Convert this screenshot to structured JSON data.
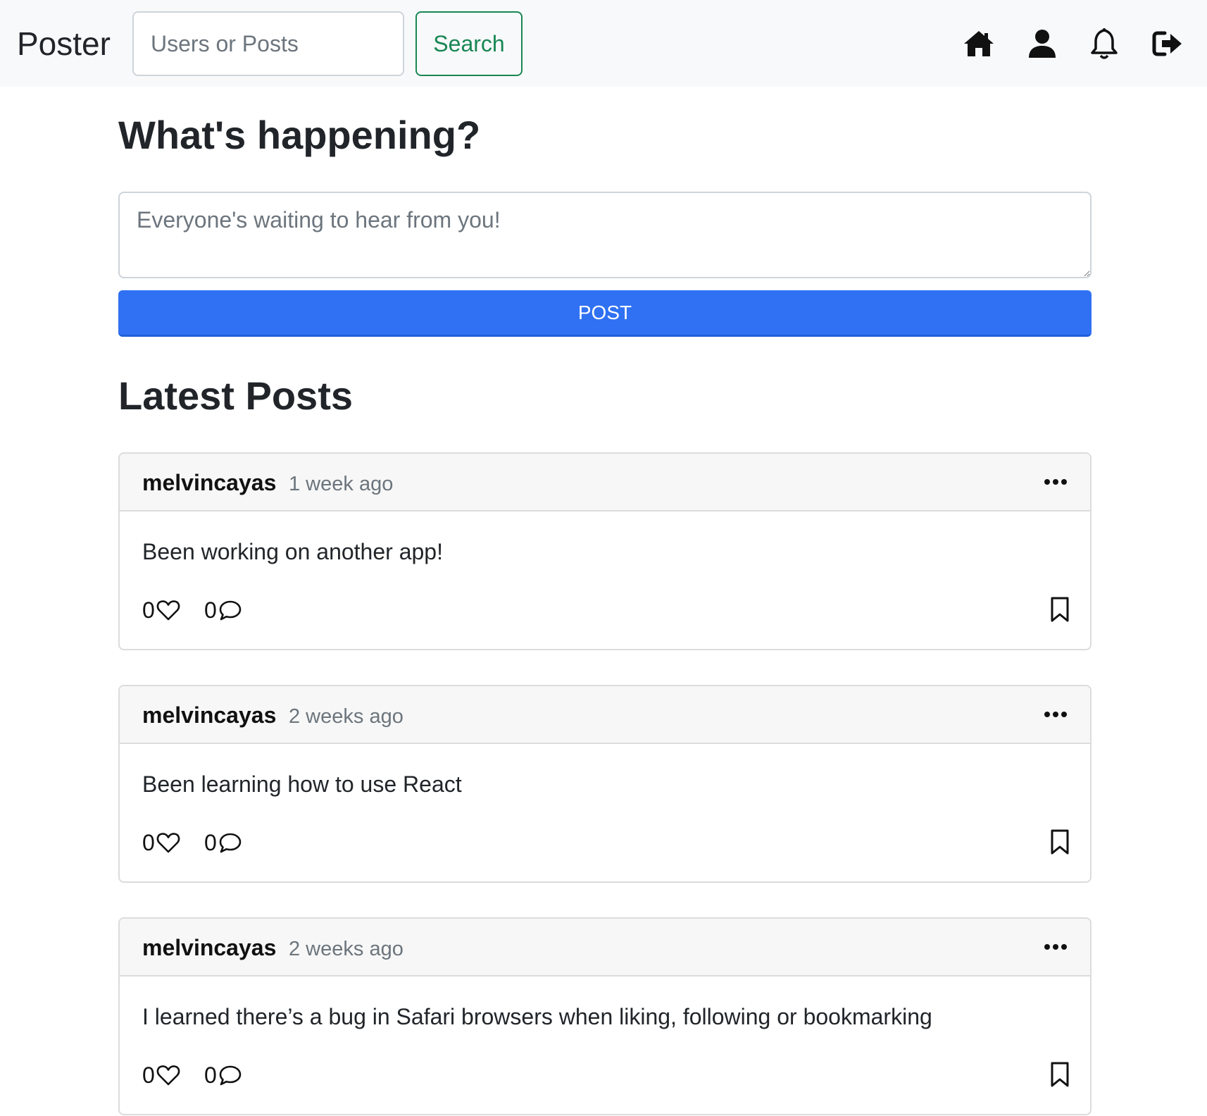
{
  "navbar": {
    "brand": "Poster",
    "search_placeholder": "Users or Posts",
    "search_button": "Search",
    "icons": [
      "home-icon",
      "user-icon",
      "bell-icon",
      "logout-icon"
    ]
  },
  "compose": {
    "title": "What's happening?",
    "placeholder": "Everyone's waiting to hear from you!",
    "post_button": "POST",
    "accent_color": "#2f71f2"
  },
  "feed": {
    "title": "Latest Posts",
    "posts": [
      {
        "username": "melvincayas",
        "time": "1 week ago",
        "body": "Been working on another app!",
        "likes": "0",
        "comments": "0"
      },
      {
        "username": "melvincayas",
        "time": "2 weeks ago",
        "body": "Been learning how to use React",
        "likes": "0",
        "comments": "0"
      },
      {
        "username": "melvincayas",
        "time": "2 weeks ago",
        "body": "I learned there’s a bug in Safari browsers when liking, following or bookmarking",
        "likes": "0",
        "comments": "0"
      }
    ]
  }
}
